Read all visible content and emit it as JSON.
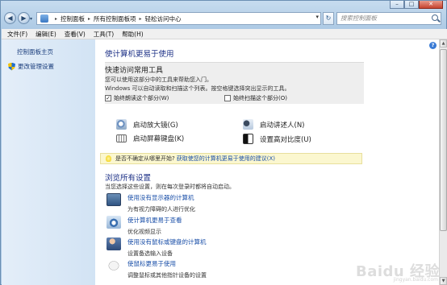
{
  "window": {
    "controls": {
      "minimize": "–",
      "maximize": "□",
      "close": "✕"
    }
  },
  "address": {
    "back": "◀",
    "forward": "▶",
    "crumbs": [
      "控制面板",
      "所有控制面板项",
      "轻松访问中心"
    ],
    "search_placeholder": "搜索控制面板"
  },
  "menu": [
    "文件(F)",
    "编辑(E)",
    "查看(V)",
    "工具(T)",
    "帮助(H)"
  ],
  "sidebar": {
    "home": "控制面板主页",
    "admin": "更改管理设置"
  },
  "main": {
    "heading": "使计算机更易于使用",
    "quick_access": {
      "title": "快速访问常用工具",
      "desc1": "您可以使用这部分中的工具来帮助您入门。",
      "desc2": "Windows 可以自动读取和扫描这个列表。按空格键选择突出显示的工具。",
      "check_read": {
        "label": "始终朗读这个部分(W)",
        "checked": true
      },
      "check_scan": {
        "label": "始终扫描这个部分(O)",
        "checked": false
      }
    },
    "tools": {
      "magnifier": "启动放大镜(G)",
      "narrator": "启动讲述人(N)",
      "keyboard": "启动屏幕键盘(K)",
      "contrast": "设置高对比度(U)"
    },
    "tip": {
      "text": "是否不确定从哪里开始?",
      "link": "获取使您的计算机更易于使用的建议(X)"
    },
    "browse": {
      "heading": "浏览所有设置",
      "sub": "当您选择这些设置，则在每次登录时都将自动启动。",
      "items": [
        {
          "link": "使用没有显示器的计算机",
          "desc": "为有视力障碍的人进行优化"
        },
        {
          "link": "使计算机更易于查看",
          "desc": "优化视频显示"
        },
        {
          "link": "使用没有鼠标或键盘的计算机",
          "desc": "设置备选输入设备"
        },
        {
          "link": "使鼠标更易于使用",
          "desc": "调整鼠标或其他指针设备的设置"
        }
      ]
    }
  },
  "watermark": {
    "text": "Baidu 经验",
    "sub": "jingyan.baidu.com"
  }
}
